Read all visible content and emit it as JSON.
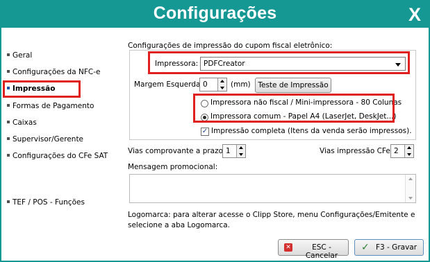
{
  "window": {
    "title": "Configurações",
    "close_glyph": "X"
  },
  "sidebar": {
    "items": [
      {
        "label": "Geral"
      },
      {
        "label": "Configurações da NFC-e"
      },
      {
        "label": "Impressão"
      },
      {
        "label": "Formas de Pagamento"
      },
      {
        "label": "Caixas"
      },
      {
        "label": "Supervisor/Gerente"
      },
      {
        "label": "Configurações do CFe SAT"
      },
      {
        "label": "TEF / POS - Funções"
      }
    ],
    "active_index": 2
  },
  "print": {
    "section_title": "Configurações de impressão do cupom fiscal eletrônico:",
    "printer_label": "Impressora:",
    "printer_value": "PDFCreator",
    "margin_label": "Margem Esquerda:",
    "margin_value": "0",
    "margin_unit": "(mm)",
    "test_button": "Teste de Impressão",
    "radio_options": [
      {
        "label": "Impressora não fiscal / Mini-impressora - 80 Colunas",
        "selected": false
      },
      {
        "label": "Impressora comum - Papel A4 (LaserJet, DeskJet...)",
        "selected": true
      }
    ],
    "complete_print_label": "Impressão completa (Itens da venda serão impressos).",
    "complete_print_checked": true
  },
  "copies": {
    "credit_label": "Vias comprovante a prazo:",
    "credit_value": "1",
    "cfe_label": "Vias impressão CFe:",
    "cfe_value": "2"
  },
  "promo": {
    "label": "Mensagem promocional:",
    "value": ""
  },
  "logo_note": {
    "line1": "Logomarca: para alterar acesse o Clipp Store, menu Configurações/Emitente e",
    "line2": "selecione a aba Logomarca."
  },
  "buttons": {
    "cancel": "ESC - Cancelar",
    "save": "F3 - Gravar"
  },
  "colors": {
    "titlebar": "#159794",
    "highlight": "#e0201f"
  }
}
